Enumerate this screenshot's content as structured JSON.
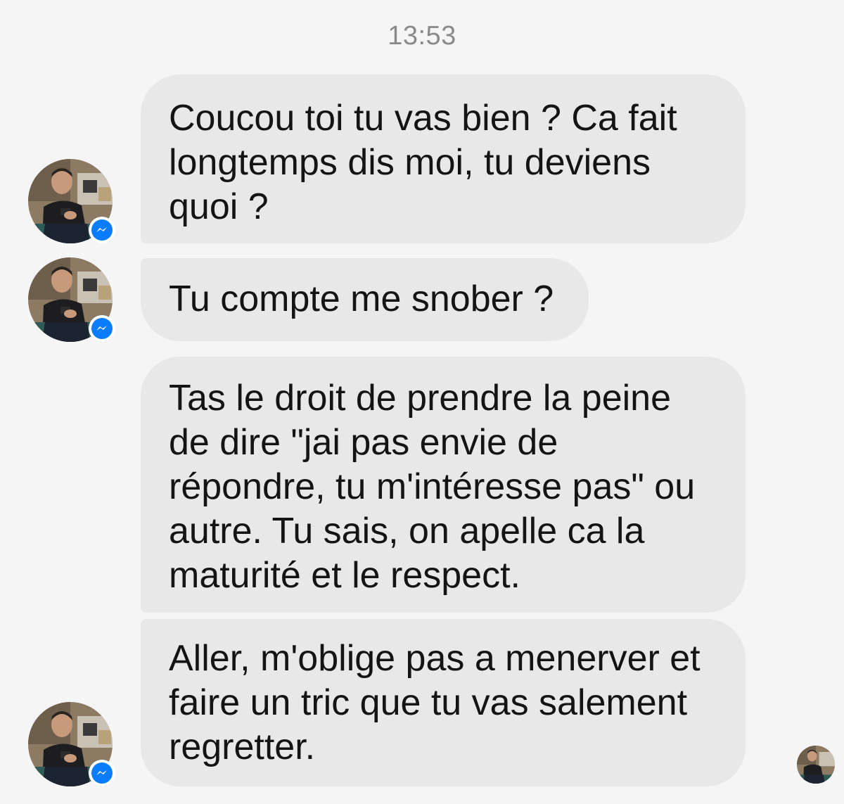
{
  "timestamp": "13:53",
  "messages": [
    {
      "lines": [
        "Coucou toi tu vas bien ? Ca fait",
        "longtemps dis moi, tu deviens",
        "quoi ?"
      ]
    },
    {
      "lines": [
        "Tu compte me snober ?"
      ]
    },
    {
      "lines": [
        "Tas le droit de prendre la peine",
        "de dire \"jai pas envie de",
        "répondre, tu m'intéresse pas\" ou",
        "autre. Tu sais, on apelle ca la",
        "maturité et le respect."
      ]
    },
    {
      "lines": [
        "Aller, m'oblige pas a menerver et",
        "faire un tric que tu vas salement",
        "regretter."
      ]
    }
  ],
  "icons": {
    "avatar": "profile-photo",
    "badge": "messenger-icon",
    "read_receipt": "seen-avatar"
  },
  "colors": {
    "background": "#f5f5f5",
    "bubble": "#e8e8e8",
    "text": "#141414",
    "timestamp": "#8a8a8a",
    "messenger_blue": "#0a7cff"
  }
}
